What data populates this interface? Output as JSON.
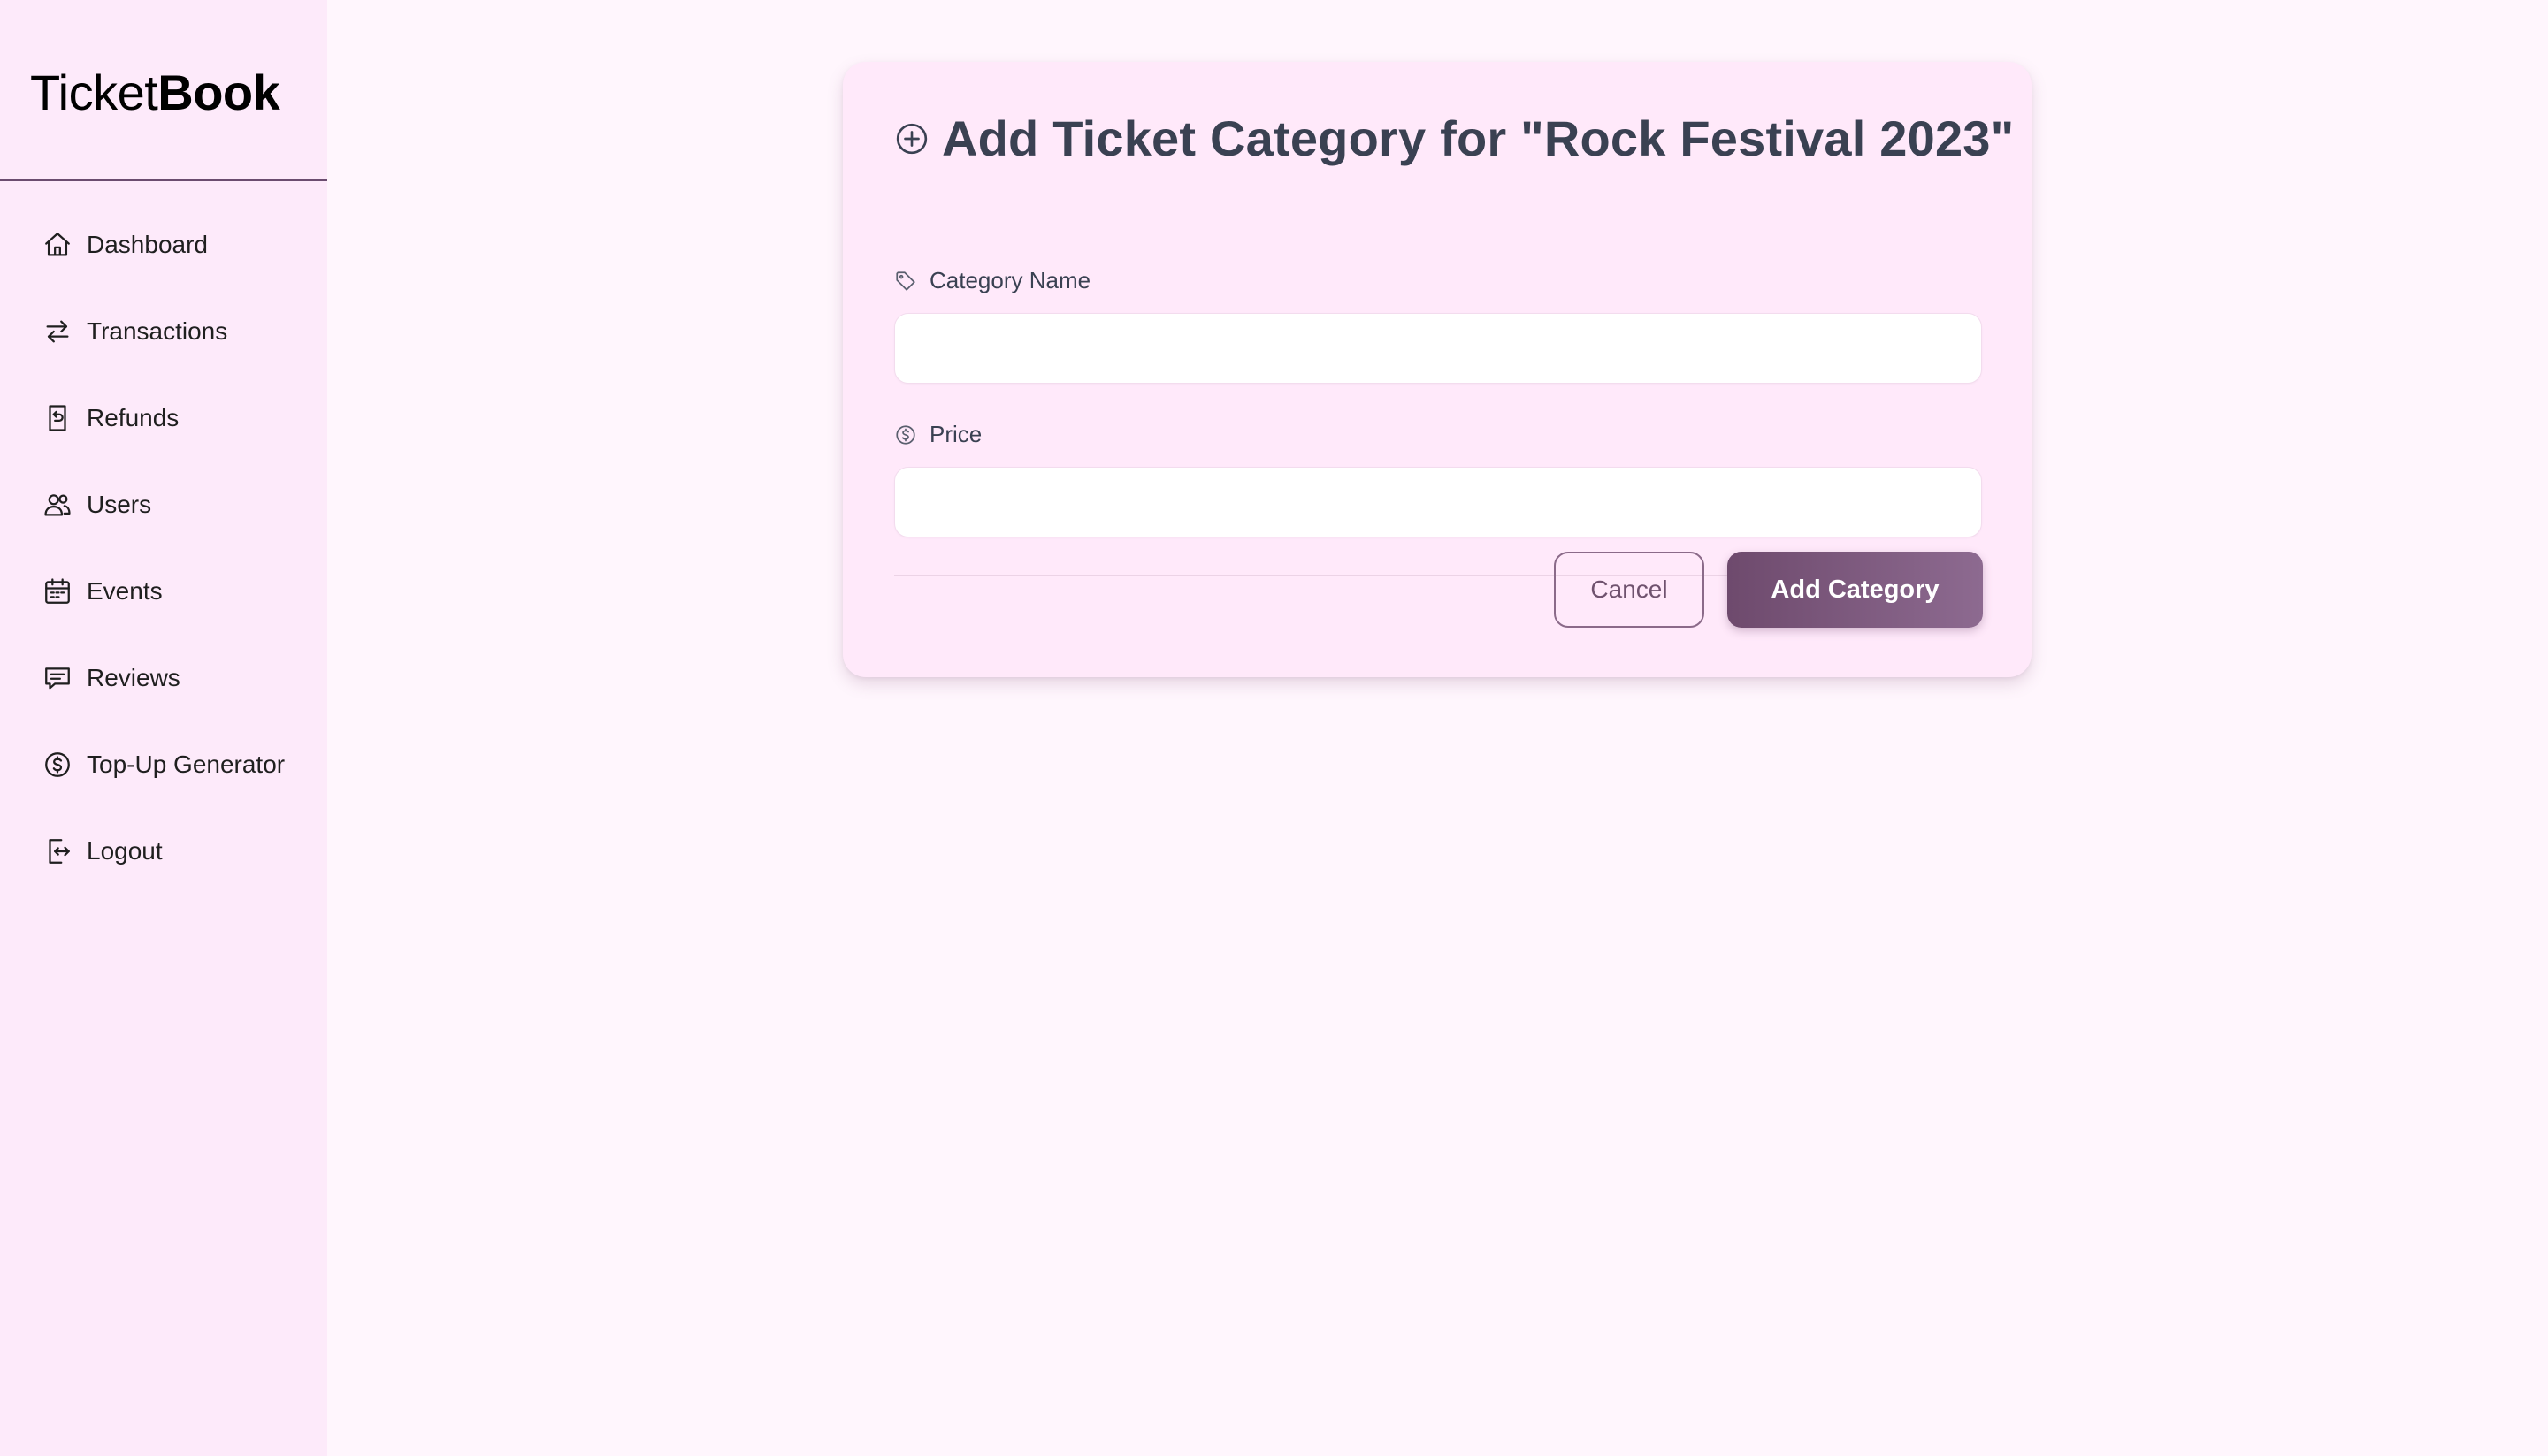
{
  "brand": {
    "regular": "Ticket",
    "bold": "Book"
  },
  "sidebar": {
    "items": [
      {
        "label": "Dashboard",
        "icon": "home-icon"
      },
      {
        "label": "Transactions",
        "icon": "arrows-exchange-icon"
      },
      {
        "label": "Refunds",
        "icon": "receipt-refund-icon"
      },
      {
        "label": "Users",
        "icon": "users-icon"
      },
      {
        "label": "Events",
        "icon": "calendar-icon"
      },
      {
        "label": "Reviews",
        "icon": "message-icon"
      },
      {
        "label": "Top-Up Generator",
        "icon": "dollar-circle-icon"
      },
      {
        "label": "Logout",
        "icon": "logout-icon"
      }
    ]
  },
  "form": {
    "title": "Add Ticket Category for \"Rock Festival 2023\"",
    "title_icon": "plus-circle-icon",
    "category_name": {
      "label": "Category Name",
      "icon": "tag-icon",
      "value": "",
      "placeholder": ""
    },
    "price": {
      "label": "Price",
      "icon": "dollar-circle-icon",
      "value": "",
      "placeholder": ""
    },
    "cancel_label": "Cancel",
    "submit_label": "Add Category"
  },
  "colors": {
    "page_bg": "#fff6fd",
    "sidebar_bg": "#fdeafa",
    "card_bg": "#ffe9fa",
    "accent": "#6e4a6d",
    "title_text": "#3a4152"
  }
}
